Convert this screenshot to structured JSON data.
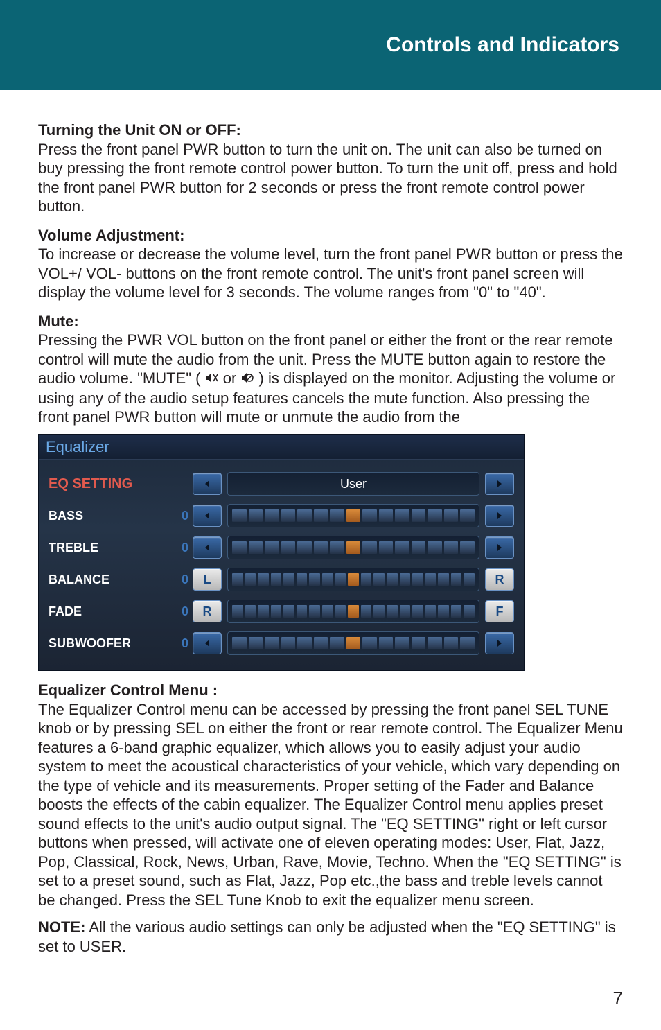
{
  "header": {
    "title": "Controls and Indicators"
  },
  "sections": {
    "turning": {
      "heading": "Turning the Unit ON or OFF:",
      "body": "Press the front panel PWR button to turn the unit on. The unit can also be turned on buy pressing the front remote control power button. To turn the unit off, press and hold the front panel PWR button for 2 seconds or press the front remote control power button."
    },
    "volume": {
      "heading": "Volume Adjustment:",
      "body": "To increase or decrease the volume level, turn the front panel PWR button or press the VOL+/ VOL- buttons on the front remote control. The unit's front panel screen will display the volume level for 3 seconds. The volume ranges from \"0\" to \"40\"."
    },
    "mute": {
      "heading": "Mute:",
      "body_pre": "Pressing the PWR VOL button on the front panel or either the front or the rear remote control will mute the audio from the unit. Press the MUTE button again to restore the audio volume. \"MUTE\" ( ",
      "body_mid": " or ",
      "body_post": " ) is displayed on the monitor. Adjusting the volume or using any of the audio setup features cancels the mute function. Also pressing the front panel PWR button will mute or unmute the audio from the"
    },
    "eq_menu": {
      "heading": "Equalizer Control Menu :",
      "body": "The Equalizer Control menu can be accessed by pressing the front panel SEL TUNE knob or by pressing SEL on either the front or rear remote control. The Equalizer Menu features a 6-band graphic equalizer, which allows you to easily adjust your audio system to meet the acoustical characteristics of your vehicle, which vary depending on the type of vehicle and its measurements. Proper setting of the Fader and Balance boosts the effects of the cabin equalizer.  The Equalizer Control menu applies preset sound effects to the unit's audio output signal. The \"EQ SETTING\" right or left cursor buttons when pressed, will activate one of eleven operating modes: User, Flat, Jazz, Pop, Classical, Rock, News, Urban, Rave, Movie, Techno. When the \"EQ SETTING\" is set to a preset sound, such as Flat, Jazz, Pop etc.,the bass and treble levels cannot be changed. Press the SEL Tune Knob to exit the equalizer menu screen."
    },
    "note": {
      "prefix": "NOTE:",
      "body": " All the various audio settings can only be adjusted when the \"EQ SETTING\" is set to USER."
    }
  },
  "equalizer": {
    "title": "Equalizer",
    "rows": {
      "eq_setting": {
        "label": "EQ SETTING",
        "value": "User"
      },
      "bass": {
        "label": "BASS",
        "val": "0"
      },
      "treble": {
        "label": "TREBLE",
        "val": "0"
      },
      "balance": {
        "label": "BALANCE",
        "val": "0",
        "left": "L",
        "right": "R"
      },
      "fade": {
        "label": "FADE",
        "val": "0",
        "left": "R",
        "right": "F"
      },
      "subwoofer": {
        "label": "SUBWOOFER",
        "val": "0"
      }
    }
  },
  "page_number": "7"
}
